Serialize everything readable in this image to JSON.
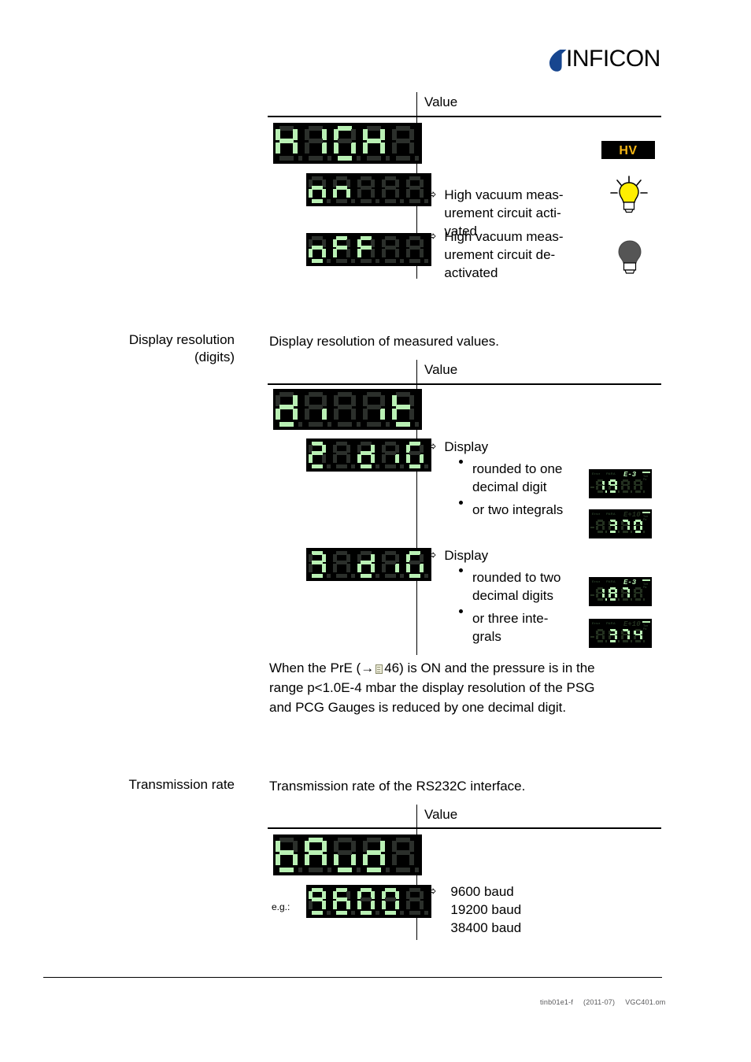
{
  "brand": {
    "name": "INFICON",
    "logo_icon": "inficon-droplet-logo",
    "accent_color": "#17468f"
  },
  "colors": {
    "led_on": "#b9f0b4",
    "led_off": "#2b2f2b",
    "panel_bg": "#000000",
    "hv_text": "#f5b614",
    "bulb_on": "#ffee00",
    "bulb_off": "#555555"
  },
  "sections": [
    {
      "id": "high-vacuum",
      "margin_label": "",
      "intro": "",
      "table": {
        "col_header_left": "",
        "col_header_right": "Value",
        "rows": [
          {
            "display": "HIGH",
            "value_lines": [],
            "indicator": "hv-badge"
          },
          {
            "display": "on",
            "value_lines": [
              "High vacuum meas-",
              "urement circuit acti-",
              "vated"
            ],
            "indicator": "bulb-on"
          },
          {
            "display": "oFF",
            "value_lines": [
              "High vacuum meas-",
              "urement circuit de-",
              "activated"
            ],
            "indicator": "bulb-off"
          }
        ]
      }
    },
    {
      "id": "display-resolution",
      "margin_label_line1": "Display resolution",
      "margin_label_line2": "(digits)",
      "intro": "Display resolution of measured values.",
      "table": {
        "col_header_right": "Value",
        "rows": [
          {
            "display": "digit"
          },
          {
            "display": "2 dig",
            "value_heading": "Display",
            "bullets": [
              {
                "lines": [
                  "rounded to one",
                  "decimal digit"
                ]
              },
              {
                "lines": [
                  "or two integrals"
                ]
              }
            ]
          },
          {
            "display": "3 dig",
            "value_heading": "Display",
            "bullets": [
              {
                "lines": [
                  "rounded to two",
                  "decimal digits"
                ]
              },
              {
                "lines": [
                  "or three inte-",
                  "grals"
                ]
              }
            ]
          }
        ]
      },
      "gauges": [
        {
          "id": "gauge-1-9",
          "sign": "-",
          "digits": "1.9",
          "exponent": "E-3",
          "exponent_lit": true,
          "labels": [
            "Error",
            "PARA"
          ],
          "units": [
            "mbar",
            "Torr",
            "Pa"
          ]
        },
        {
          "id": "gauge-370",
          "sign": "-",
          "digits": "370",
          "exponent": "E+10",
          "exponent_lit": false,
          "labels": [
            "Error",
            "PARA"
          ],
          "units": [
            "mbar",
            "Torr",
            "Pa"
          ]
        },
        {
          "id": "gauge-1-87",
          "sign": "-",
          "digits": "1.87",
          "exponent": "E-3",
          "exponent_lit": true,
          "labels": [
            "Error",
            "PARA"
          ],
          "units": [
            "mbar",
            "Torr",
            "Pa"
          ]
        },
        {
          "id": "gauge-374",
          "sign": "-",
          "digits": "374",
          "exponent": "E+10",
          "exponent_lit": false,
          "labels": [
            "Error",
            "PARA"
          ],
          "units": [
            "mbar",
            "Torr",
            "Pa"
          ]
        }
      ],
      "note_lines": [
        "When the PrE (→   46) is ON and the pressure is in the",
        "range p<1.0E-4 mbar the display resolution of the PSG",
        "and PCG Gauges is reduced by one decimal digit."
      ],
      "note_part_1": "When the PrE (→",
      "note_page_ref": "46) is ON and the pressure is in the",
      "note_line_2": "range p<1.0E-4 mbar the display resolution of the PSG",
      "note_line_3": "and PCG Gauges is reduced by one decimal digit."
    },
    {
      "id": "transmission-rate",
      "margin_label": "Transmission rate",
      "intro": "Transmission rate of the RS232C interface.",
      "table": {
        "col_header_right": "Value",
        "rows": [
          {
            "display": "bAud"
          },
          {
            "display": "9600",
            "prefix_label": "e.g.:",
            "value_lines": [
              "9600 baud",
              "19200 baud",
              "38400 baud"
            ]
          }
        ]
      }
    }
  ],
  "footer": {
    "doc_id": "tinb01e1-f",
    "date": "(2011-07)",
    "file": "VGC401.om"
  }
}
